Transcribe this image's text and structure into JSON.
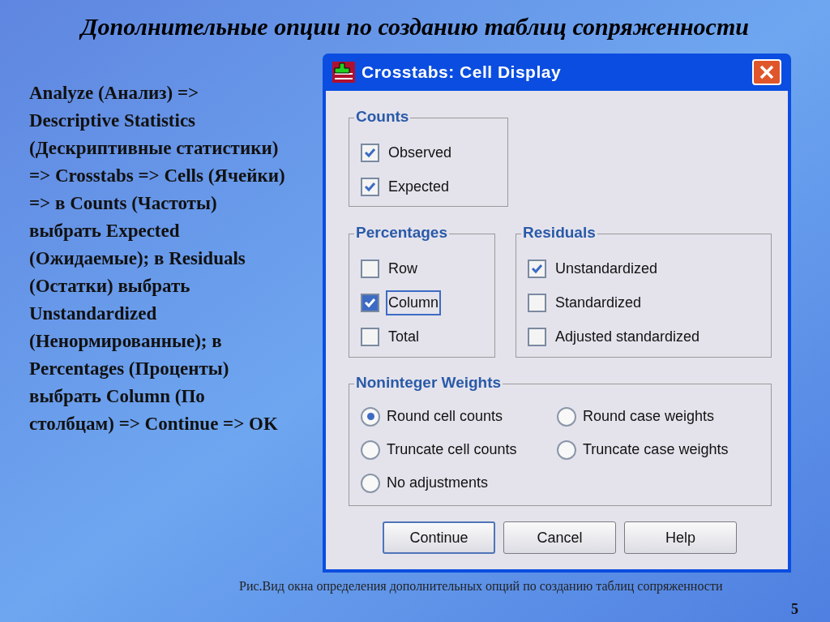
{
  "slide": {
    "title": "Дополнительные опции по созданию таблиц сопряженности",
    "instructions": "Analyze (Анализ) => Descriptive Statistics (Дескриптивные статистики) => Crosstabs => Cells (Ячейки) => в Counts (Частоты) выбрать Expected (Ожидаемые); в Residuals (Остатки) выбрать Unstandardized (Ненормированные); в Percentages (Проценты) выбрать Column (По столбцам) => Continue => OK",
    "caption": "Рис.Вид окна определения дополнительных опций по созданию таблиц сопряженности",
    "page_number": "5"
  },
  "dialog": {
    "title": "Crosstabs: Cell Display",
    "counts": {
      "title": "Counts",
      "options": [
        {
          "label": "Observed",
          "checked": true,
          "focused": false
        },
        {
          "label": "Expected",
          "checked": true,
          "focused": false
        }
      ]
    },
    "percentages": {
      "title": "Percentages",
      "options": [
        {
          "label": "Row",
          "checked": false,
          "focused": false
        },
        {
          "label": "Column",
          "checked": true,
          "focused": true
        },
        {
          "label": "Total",
          "checked": false,
          "focused": false
        }
      ]
    },
    "residuals": {
      "title": "Residuals",
      "options": [
        {
          "label": "Unstandardized",
          "checked": true,
          "focused": false
        },
        {
          "label": "Standardized",
          "checked": false,
          "focused": false
        },
        {
          "label": "Adjusted standardized",
          "checked": false,
          "focused": false
        }
      ]
    },
    "noninteger_weights": {
      "title": "Noninteger Weights",
      "options": [
        {
          "label": "Round cell counts",
          "selected": true
        },
        {
          "label": "Round case weights",
          "selected": false
        },
        {
          "label": "Truncate cell counts",
          "selected": false
        },
        {
          "label": "Truncate case weights",
          "selected": false
        },
        {
          "label": "No adjustments",
          "selected": false
        }
      ]
    },
    "buttons": [
      {
        "label": "Continue",
        "default": true
      },
      {
        "label": "Cancel",
        "default": false
      },
      {
        "label": "Help",
        "default": false
      }
    ]
  }
}
